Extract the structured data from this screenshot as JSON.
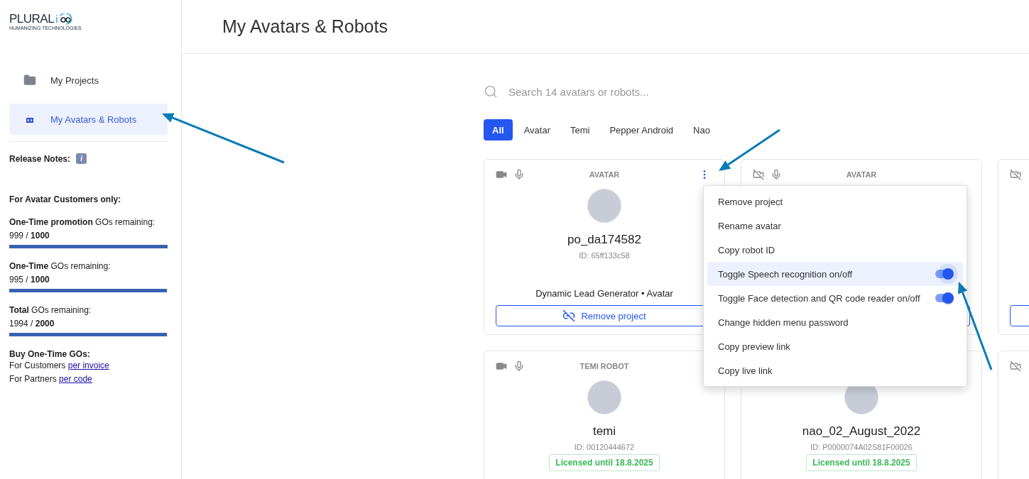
{
  "logo": {
    "wordmark": "PLURAL",
    "mark": "i",
    "tagline": "HUMANIZING TECHNOLOGIES"
  },
  "sidebar": {
    "items": [
      {
        "label": "My Projects",
        "selected": false
      },
      {
        "label": "My Avatars & Robots",
        "selected": true
      }
    ],
    "release_notes": {
      "label": "Release Notes:",
      "badge": "i"
    },
    "section_title": "For Avatar Customers only:",
    "quotas": [
      {
        "label": "**One-Time promotion** GOs remaining:",
        "reading": "999 / **1000**",
        "level": 0.999
      },
      {
        "label": "**One-Time** GOs remaining:",
        "reading": "995 / **1000**",
        "level": 0.995
      },
      {
        "label": "**Total** GOs remaining:",
        "reading": "1994 / **2000**",
        "level": 0.997
      }
    ],
    "buy": {
      "title": "Buy One-Time GOs:",
      "lines": [
        {
          "text": "For Customers",
          "link": "per invoice"
        },
        {
          "text": "For Partners",
          "link": "per code"
        }
      ]
    }
  },
  "header": {
    "title": "My Avatars & Robots"
  },
  "search": {
    "placeholder": "Search 14 avatars or robots..."
  },
  "filters": [
    {
      "label": "All",
      "selected": true
    },
    {
      "label": "Avatar",
      "selected": false
    },
    {
      "label": "Temi",
      "selected": false
    },
    {
      "label": "Pepper Android",
      "selected": false
    },
    {
      "label": "Nao",
      "selected": false
    }
  ],
  "cards": [
    {
      "type_label": "AVATAR",
      "camera_on": true,
      "mic": true,
      "menu_button": true,
      "avatar": true,
      "name": "po_da174582",
      "id": "ID: 65ff133c58",
      "subtitle": "Dynamic Lead Generator • Avatar",
      "button": "Remove project"
    },
    {
      "type_label": "AVATAR",
      "camera_on": false,
      "mic": true,
      "button_outline": true
    },
    {
      "camera_on": false,
      "button_outline": true
    },
    {
      "type_label": "TEMI ROBOT",
      "camera_on": true,
      "mic": true,
      "avatar": true,
      "name": "temi",
      "id": "ID: 00120444672",
      "license": "Licensed until 18.8.2025"
    },
    {
      "avatar": true,
      "name": "nao_02_August_2022",
      "id": "ID: P0000074A02S81F00026",
      "license": "Licensed until 18.8.2025"
    },
    {
      "camera_on": false
    }
  ],
  "context_menu": {
    "items": [
      {
        "label": "Remove project",
        "kind": "action",
        "highlighted": false
      },
      {
        "label": "Rename avatar",
        "kind": "action",
        "highlighted": false
      },
      {
        "label": "Copy robot ID",
        "kind": "action",
        "highlighted": false
      },
      {
        "label": "Toggle Speech recognition on/off",
        "kind": "toggle",
        "on": true,
        "highlighted": true
      },
      {
        "label": "Toggle Face detection and QR code reader on/off",
        "kind": "toggle",
        "on": true,
        "highlighted": false
      },
      {
        "label": "Change hidden menu password",
        "kind": "action",
        "highlighted": false
      },
      {
        "label": "Copy preview link",
        "kind": "action",
        "highlighted": false
      },
      {
        "label": "Copy live link",
        "kind": "action",
        "highlighted": false
      }
    ]
  }
}
